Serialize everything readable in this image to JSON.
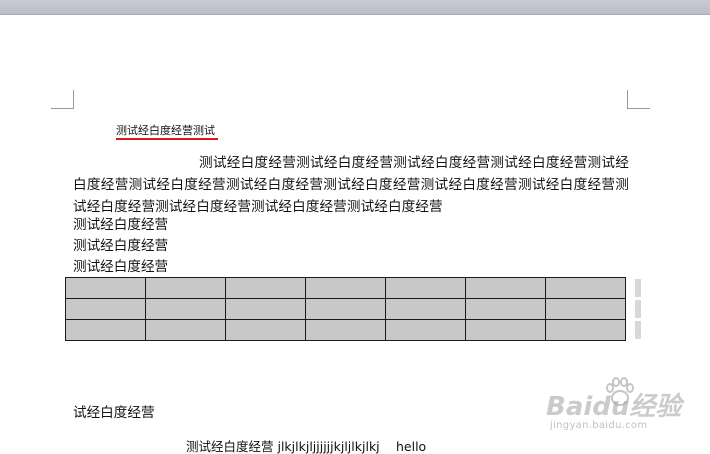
{
  "document": {
    "heading": "测试经白度经营测试",
    "paragraph": "测试经白度经营测试经白度经营测试经白度经营测试经白度经营测试经白度经营测试经白度经营测试经白度经营测试经白度经营测试经白度经营测试经白度经营测试经白度经营测试经白度经营测试经白度经营测试经白度经营",
    "lines": [
      "测试经白度经营",
      "测试经白度经营",
      "测试经白度经营"
    ],
    "table": {
      "rows": 3,
      "columns": 7,
      "cells": [
        [
          "",
          "",
          "",
          "",
          "",
          "",
          ""
        ],
        [
          "",
          "",
          "",
          "",
          "",
          "",
          ""
        ],
        [
          "",
          "",
          "",
          "",
          "",
          "",
          ""
        ]
      ]
    },
    "after_table_line": "试经白度经营",
    "bottom_line_cn": "测试经白度经营 jlkjlkjljjjjjjkjljlkjlkj",
    "bottom_line_hello": "hello"
  },
  "colors": {
    "heading_underline": "#e0141c",
    "table_fill": "#c8c8c8",
    "topbar": "#c4c7d1"
  },
  "watermark": {
    "brand": "Baidu经验",
    "url": "jingyan.baidu.com"
  }
}
